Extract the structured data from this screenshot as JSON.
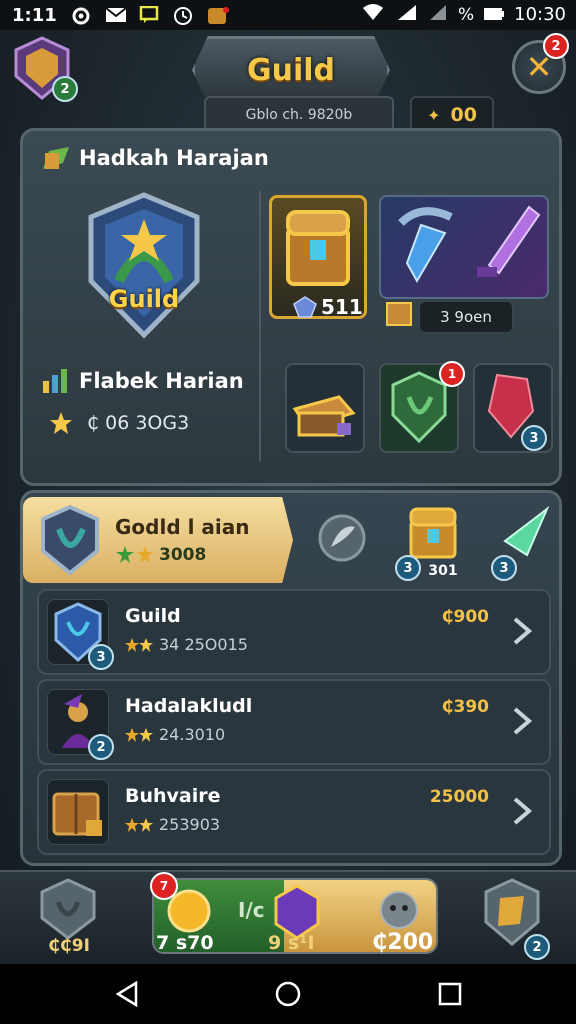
{
  "status_bar": {
    "time": "1:11",
    "clock": "10:30",
    "battery_text": "%"
  },
  "header": {
    "title": "Guild",
    "subtitle": "Gblo ch. 9820b",
    "currency_value": "00",
    "close_badge": "2",
    "avatar_badge": "2"
  },
  "upper_panel": {
    "section_title": "Hadkah Harajan",
    "guild_emblem_label": "Guild",
    "stat_title": "Flabek Harian",
    "stat_value": "₵ 06 3OG3",
    "chest_value": "511",
    "price_pill": "3 9oen",
    "red_badge": "1",
    "gem_badge": "3"
  },
  "lower_panel": {
    "highlight": {
      "name": "Godld l aian",
      "value": "3008"
    },
    "rewards": [
      {
        "icon": "feather-icon",
        "value": ""
      },
      {
        "icon": "chest-icon",
        "badge": "3",
        "value": "301"
      },
      {
        "icon": "gem-icon",
        "badge": "3",
        "value": ""
      }
    ],
    "items": [
      {
        "name": "Guild",
        "sub": "34 25O015",
        "price": "₵900",
        "badge": "3"
      },
      {
        "name": "Hadalakludl",
        "sub": "24.3010",
        "price": "₵390",
        "badge": "2"
      },
      {
        "name": "Buhvaire",
        "sub": "253903",
        "price": "25000",
        "badge": ""
      }
    ]
  },
  "bottom_bar": {
    "left_label": "₵₵9I",
    "center_badge": "7",
    "center_left_value": "7 s70",
    "center_mid": "I/c",
    "center_right_value": "9 s¹I",
    "center_far_value": "₵200",
    "right_badge": "2"
  },
  "colors": {
    "accent_gold": "#f5c84a",
    "panel_bg": "#344249",
    "highlight_bg": "#f0d38c"
  }
}
